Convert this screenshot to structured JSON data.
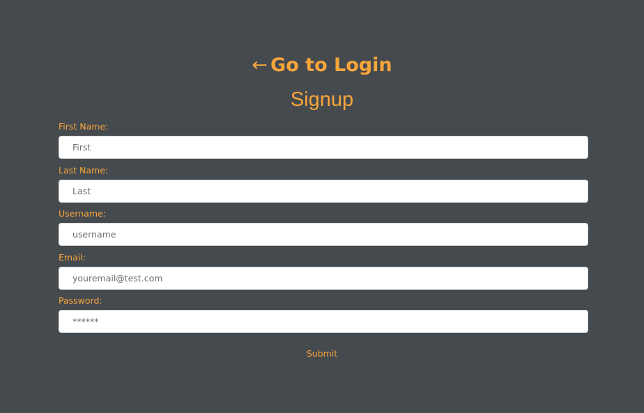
{
  "nav": {
    "back_arrow": "←",
    "go_to_login": "Go to Login"
  },
  "page": {
    "title": "Signup"
  },
  "form": {
    "fields": [
      {
        "label": "First Name:",
        "placeholder": "First",
        "type": "text"
      },
      {
        "label": "Last Name:",
        "placeholder": "Last",
        "type": "text"
      },
      {
        "label": "Username:",
        "placeholder": "username",
        "type": "text"
      },
      {
        "label": "Email:",
        "placeholder": "youremail@test.com",
        "type": "email"
      },
      {
        "label": "Password:",
        "placeholder": "******",
        "type": "password"
      }
    ],
    "submit_label": "Submit"
  },
  "colors": {
    "background": "#454a4f",
    "accent": "#f7a53a",
    "input_background": "#ffffff"
  }
}
